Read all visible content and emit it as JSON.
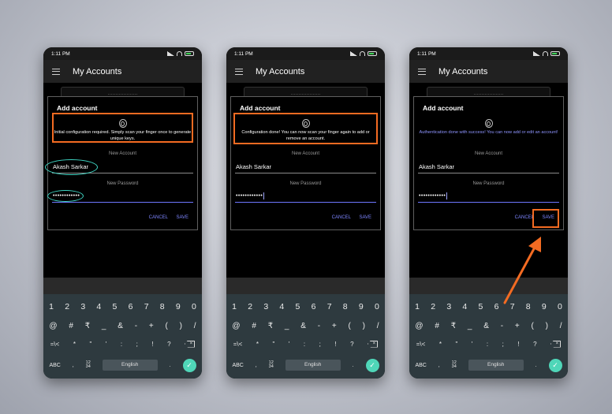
{
  "colors": {
    "highlight": "#f36b22",
    "annotation_oval": "#3fd6c4",
    "accent": "#7d85ff",
    "success_text": "#8f95ff",
    "enter_key": "#4fd6b8"
  },
  "phones": [
    {
      "status_time": "1:11 PM",
      "app_title": "My Accounts",
      "dialog_title": "Add account",
      "message": "Initial configuration required. Simply scan your finger once to generate unique keys.",
      "message_style": "normal",
      "new_account_label": "New Account",
      "account_value": "Akash Sarkar",
      "new_password_label": "New Password",
      "password_value": "••••••••••••",
      "cancel_label": "CANCEL",
      "save_label": "SAVE"
    },
    {
      "status_time": "1:11 PM",
      "app_title": "My Accounts",
      "dialog_title": "Add account",
      "message": "Configuration done! You can now scan your finger again to add or remove an account.",
      "message_style": "normal",
      "new_account_label": "New Account",
      "account_value": "Akash Sarkar",
      "new_password_label": "New Password",
      "password_value": "••••••••••••",
      "cancel_label": "CANCEL",
      "save_label": "SAVE"
    },
    {
      "status_time": "1:11 PM",
      "app_title": "My Accounts",
      "dialog_title": "Add account",
      "message": "Authentication done with success! You can now add or edit an account!",
      "message_style": "success",
      "new_account_label": "New Account",
      "account_value": "Akash Sarkar",
      "new_password_label": "New Password",
      "password_value": "••••••••••••",
      "cancel_label": "CANCEL",
      "save_label": "SAVE"
    }
  ],
  "keyboard": {
    "numbers": [
      "1",
      "2",
      "3",
      "4",
      "5",
      "6",
      "7",
      "8",
      "9",
      "0"
    ],
    "symbols": [
      "@",
      "#",
      "₹",
      "_",
      "&",
      "-",
      "+",
      "(",
      ")",
      "/"
    ],
    "extra": [
      "=\\<",
      "*",
      "\"",
      "'",
      ":",
      ";",
      "!",
      "?"
    ],
    "abc_label": "ABC",
    "comma": ",",
    "ratio_top": "12",
    "ratio_bottom": "34",
    "space_label": "English",
    "period": ".",
    "enter_symbol": "✓",
    "backspace_symbol": "×"
  }
}
